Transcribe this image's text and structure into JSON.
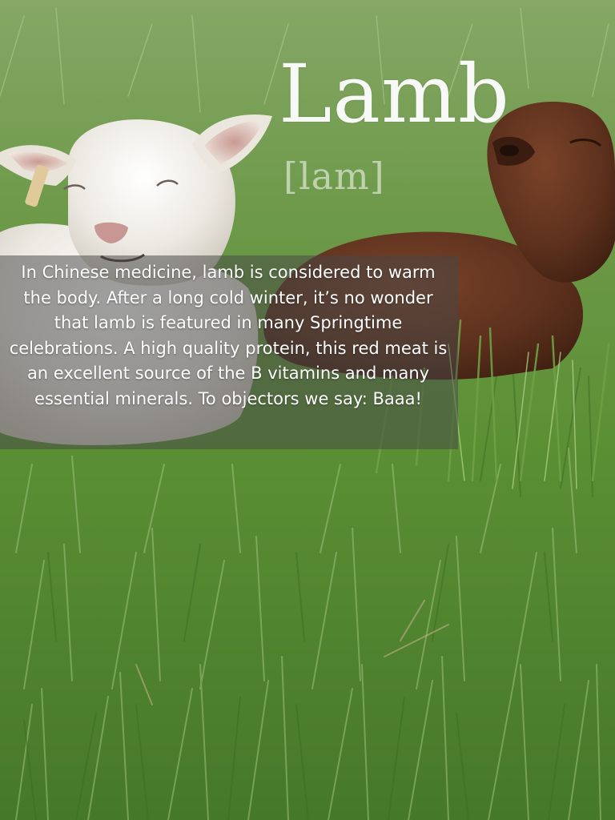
{
  "title": "Lamb",
  "phonetic": "[lam]",
  "caption": "In Chinese medicine, lamb is considered to warm the body. After a long cold winter, it’s no wonder that lamb is featured in many Springtime celebrations.  A high quality protein, this red meat is an excellent source of the B vitamins and many essential minerals. To objectors we say: Baaa!",
  "colors": {
    "grass_light": "#8fb86a",
    "grass_dark": "#3f7a24",
    "white_lamb": "#f2f0ec",
    "brown_lamb": "#5a2f1a",
    "caption_panel": "#464646"
  }
}
